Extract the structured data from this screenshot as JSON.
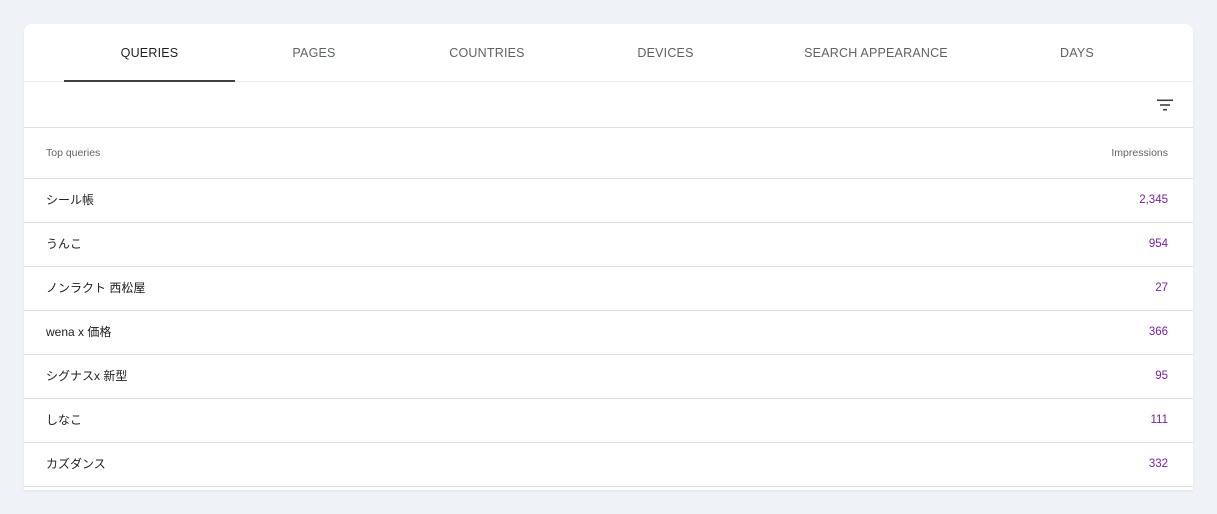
{
  "tabs": [
    {
      "label": "QUERIES",
      "active": true
    },
    {
      "label": "PAGES",
      "active": false
    },
    {
      "label": "COUNTRIES",
      "active": false
    },
    {
      "label": "DEVICES",
      "active": false
    },
    {
      "label": "SEARCH APPEARANCE",
      "active": false
    },
    {
      "label": "DAYS",
      "active": false
    }
  ],
  "toolbar": {
    "filter_icon": "filter-list-icon"
  },
  "table": {
    "header_left": "Top queries",
    "header_right": "Impressions",
    "rows": [
      {
        "query": "シール帳",
        "impressions": "2,345"
      },
      {
        "query": "うんこ",
        "impressions": "954"
      },
      {
        "query": "ノンラクト 西松屋",
        "impressions": "27"
      },
      {
        "query": "wena x 価格",
        "impressions": "366"
      },
      {
        "query": "シグナスx 新型",
        "impressions": "95"
      },
      {
        "query": "しなこ",
        "impressions": "111"
      },
      {
        "query": "カズダンス",
        "impressions": "332"
      }
    ]
  },
  "colors": {
    "page_background": "#eff2f7",
    "impressions_value": "#7b1fa2",
    "active_tab_indicator": "#3c4043"
  }
}
